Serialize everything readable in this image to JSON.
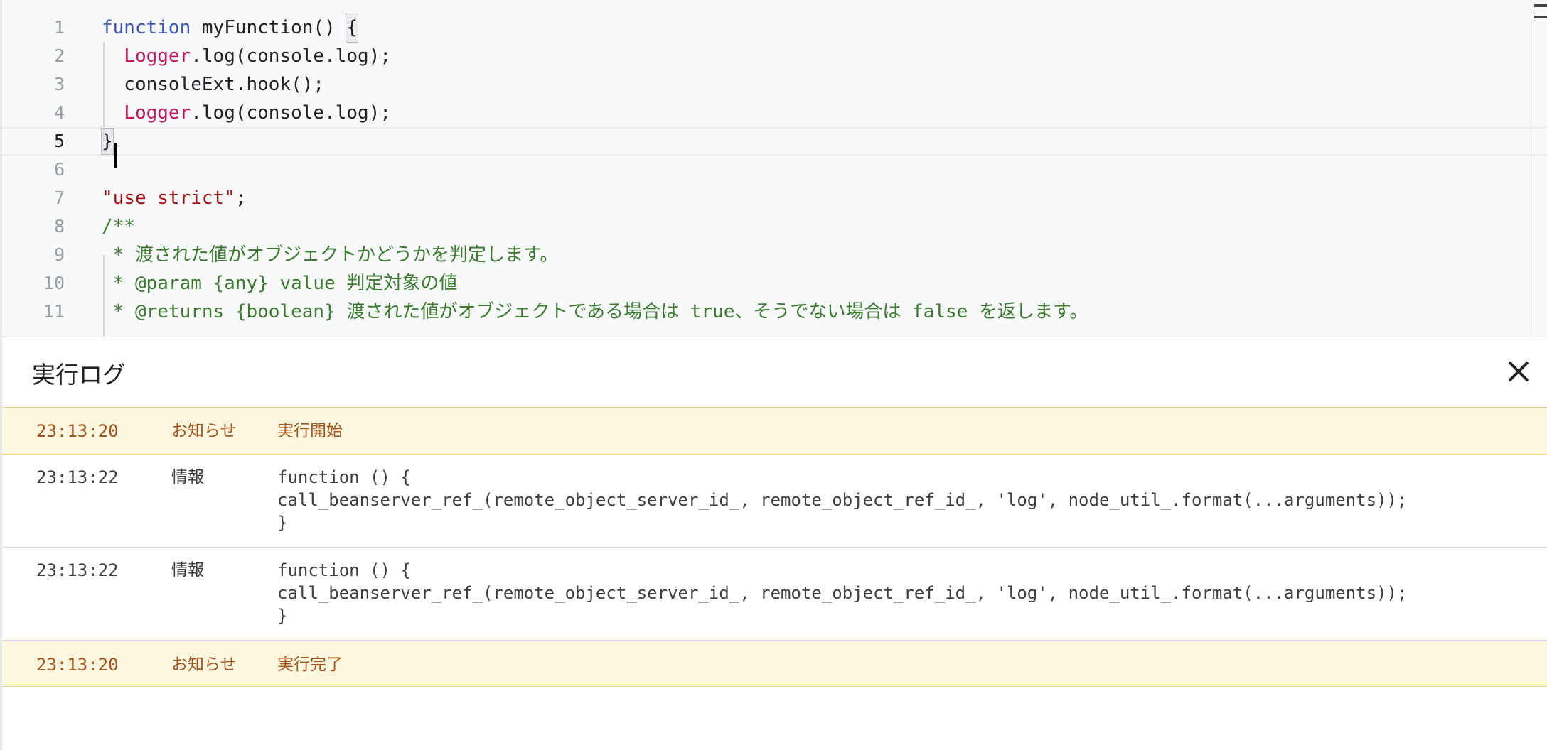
{
  "editor": {
    "lines": [
      {
        "number": "1",
        "parts": [
          {
            "t": "function",
            "c": "kw"
          },
          {
            "t": " myFunction() "
          },
          {
            "t": "{",
            "c": "brace"
          }
        ]
      },
      {
        "number": "2",
        "parts": [
          {
            "t": "  "
          },
          {
            "t": "Logger",
            "c": "cls"
          },
          {
            "t": ".log(console.log);"
          }
        ]
      },
      {
        "number": "3",
        "parts": [
          {
            "t": "  consoleExt.hook();"
          }
        ]
      },
      {
        "number": "4",
        "parts": [
          {
            "t": "  "
          },
          {
            "t": "Logger",
            "c": "cls"
          },
          {
            "t": ".log(console.log);"
          }
        ]
      },
      {
        "number": "5",
        "parts": [
          {
            "t": "}",
            "c": "brace"
          }
        ],
        "current": true
      },
      {
        "number": "6",
        "parts": []
      },
      {
        "number": "7",
        "parts": [
          {
            "t": "\"use strict\"",
            "c": "str"
          },
          {
            "t": ";"
          }
        ]
      },
      {
        "number": "8",
        "parts": [
          {
            "t": "/**",
            "c": "cmt"
          }
        ]
      },
      {
        "number": "9",
        "parts": [
          {
            "t": " * 渡された値がオブジェクトかどうかを判定します。",
            "c": "cmt"
          }
        ]
      },
      {
        "number": "10",
        "parts": [
          {
            "t": " * @param {any} value 判定対象の値",
            "c": "cmt"
          }
        ]
      },
      {
        "number": "11",
        "parts": [
          {
            "t": " * @returns {boolean} 渡された値がオブジェクトである場合は true、そうでない場合は false を返します。",
            "c": "cmt"
          }
        ]
      }
    ]
  },
  "log_panel": {
    "title": "実行ログ",
    "close_icon": "close-icon",
    "entries": [
      {
        "time": "23:13:20",
        "level": "お知らせ",
        "kind": "notice",
        "message": [
          "実行開始"
        ]
      },
      {
        "time": "23:13:22",
        "level": "情報",
        "kind": "info",
        "message": [
          "function () {",
          "call_beanserver_ref_(remote_object_server_id_, remote_object_ref_id_, 'log', node_util_.format(...arguments));",
          "}"
        ]
      },
      {
        "time": "23:13:22",
        "level": "情報",
        "kind": "info",
        "message": [
          "function () {",
          "call_beanserver_ref_(remote_object_server_id_, remote_object_ref_id_, 'log', node_util_.format(...arguments));",
          "}"
        ]
      },
      {
        "time": "23:13:20",
        "level": "お知らせ",
        "kind": "notice",
        "message": [
          "実行完了"
        ]
      }
    ]
  },
  "colors": {
    "editor_bg": "#f8f9fa",
    "keyword": "#3a56b4",
    "class_name": "#c2185b",
    "string": "#a31515",
    "comment": "#3b7a2f",
    "notice_bg": "#fef7e0",
    "notice_text": "#a5541a"
  }
}
